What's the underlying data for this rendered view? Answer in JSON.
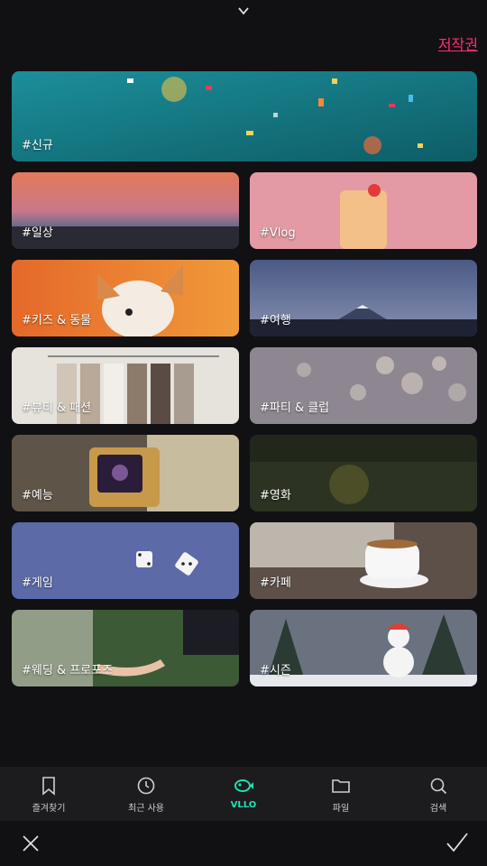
{
  "header": {
    "copyright_link": "저작권",
    "collapse_icon": "chevron-down-icon"
  },
  "categories": [
    {
      "label": "#신규"
    },
    {
      "label": "#일상"
    },
    {
      "label": "#Vlog"
    },
    {
      "label": "#키즈 & 동물"
    },
    {
      "label": "#여행"
    },
    {
      "label": "#뷰티 & 패션"
    },
    {
      "label": "#파티 & 클럽"
    },
    {
      "label": "#예능"
    },
    {
      "label": "#영화"
    },
    {
      "label": "#게임"
    },
    {
      "label": "#카페"
    },
    {
      "label": "#웨딩 & 프로포즈"
    },
    {
      "label": "#시즌"
    }
  ],
  "bottom_nav": {
    "items": [
      {
        "label": "즐겨찾기",
        "icon": "bookmark-icon"
      },
      {
        "label": "최근 사용",
        "icon": "history-icon"
      },
      {
        "label": "VLLO",
        "icon": "vllo-fish-icon",
        "active": true
      },
      {
        "label": "파일",
        "icon": "folder-icon"
      },
      {
        "label": "검색",
        "icon": "search-icon"
      }
    ]
  },
  "actions": {
    "close_icon": "close-icon",
    "confirm_icon": "checkmark-icon"
  },
  "colors": {
    "accent": "#22e0b0",
    "link": "#ff2d6f",
    "background": "#111114",
    "nav_bg": "#1c1c1f"
  }
}
